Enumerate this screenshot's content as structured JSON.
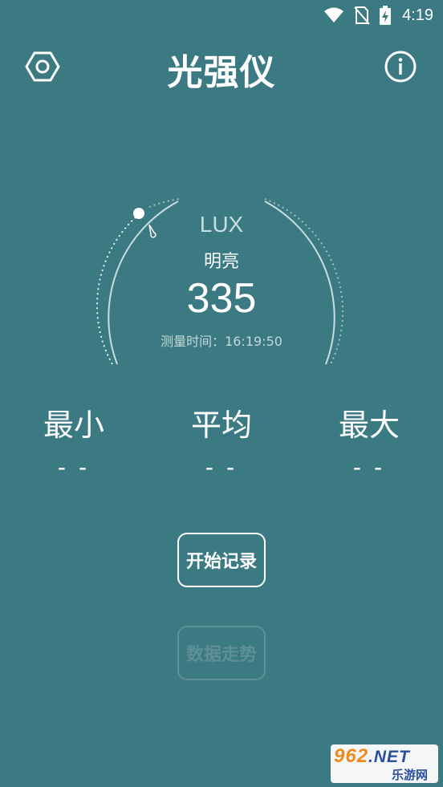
{
  "status_bar": {
    "time": "4:19",
    "icons": [
      "wifi-icon",
      "no-sim-icon",
      "battery-charging-icon"
    ]
  },
  "app_bar": {
    "title": "光强仪",
    "settings_icon": "hexagon-settings-icon",
    "info_icon": "info-circle-icon"
  },
  "gauge": {
    "unit": "LUX",
    "level": "明亮",
    "value": "335",
    "time_label": "测量时间：16:19:50"
  },
  "stats": {
    "min": {
      "label": "最小",
      "value": "- -"
    },
    "avg": {
      "label": "平均",
      "value": "- -"
    },
    "max": {
      "label": "最大",
      "value": "- -"
    }
  },
  "buttons": {
    "start_record": "开始记录",
    "data_trend": "数据走势"
  },
  "watermark": {
    "logo_number": "962",
    "logo_suffix": ".NET",
    "logo_text": "乐游网"
  },
  "colors": {
    "background": "#3b7a82",
    "foreground": "#ffffff",
    "disabled": "#5f8f96",
    "watermark_orange": "#f08a1d",
    "watermark_blue": "#2a4f9c"
  }
}
